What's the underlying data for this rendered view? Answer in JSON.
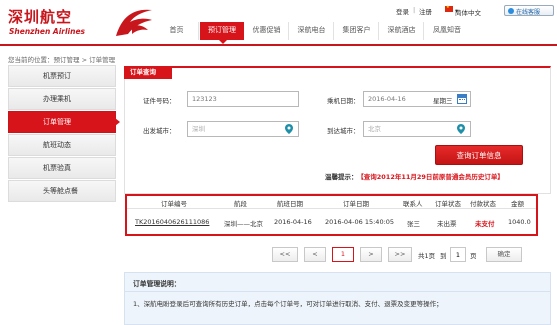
{
  "brand": {
    "name_cn": "深圳航空",
    "name_en": "Shenzhen Airlines",
    "color": "#c8161d"
  },
  "top_links": {
    "login": "登录",
    "separator": "|",
    "register": "注册",
    "language": "简体中文",
    "language_caret": "▾",
    "service": "在线客服"
  },
  "nav": {
    "items": [
      "首页",
      "预订管理",
      "优惠促销",
      "深航电台",
      "集团客户",
      "深航酒店",
      "凤凰知音"
    ],
    "active_index": 1
  },
  "breadcrumb": "您当前的位置：预订管理 > 订单管理",
  "sidebar": {
    "items": [
      "机票预订",
      "办理乘机",
      "订单管理",
      "航班动态",
      "机票验真",
      "头等舱点餐"
    ],
    "active_index": 2
  },
  "search": {
    "tab_label": "订单查询",
    "cert_label": "证件号码：",
    "cert_value": "123123",
    "date_label": "乘机日期：",
    "date_value": "2016-04-16",
    "weekday": "星期三",
    "dep_label": "出发城市：",
    "dep_placeholder": "深圳",
    "arr_label": "到达城市：",
    "arr_placeholder": "北京",
    "button_label": "查询订单信息",
    "notice_label": "温馨提示：",
    "notice_text": "【查询2012年11月29日前原普通会员历史订单】"
  },
  "table": {
    "headers": [
      "订单编号",
      "航段",
      "航班日期",
      "订单日期",
      "联系人",
      "订单状态",
      "付款状态",
      "金额"
    ],
    "rows": [
      {
        "order_no": "TK2016040626111086",
        "route": "深圳——北京",
        "flight_date": "2016-04-16",
        "order_date": "2016-04-06 15:40:05",
        "contact": "张三",
        "order_status": "未出票",
        "pay_status": "未支付",
        "amount": "1040.0"
      }
    ]
  },
  "pager": {
    "first": "<<",
    "prev": "<",
    "current": "1",
    "next": ">",
    "last": ">>",
    "total_text": "共1页",
    "goto_prefix": "到",
    "goto_value": "1",
    "goto_suffix": "页",
    "confirm": "确定"
  },
  "help": {
    "title": "订单管理说明：",
    "line1": "1、深航电盼登录后可查询所有历史订单，点击每个订单号，可对订单进行取消、支付、退票及变更等操作；"
  }
}
